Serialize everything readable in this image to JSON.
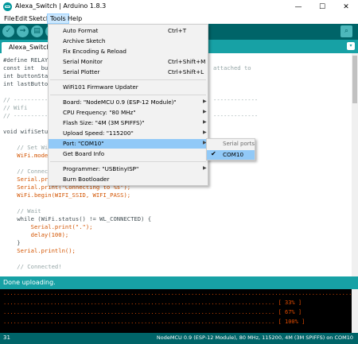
{
  "window": {
    "title": "Alexa_Switch | Arduino 1.8.3"
  },
  "menubar": [
    "File",
    "Edit",
    "Sketch",
    "Tools",
    "Help"
  ],
  "tabs": {
    "sketch": "Alexa_Switch",
    "arrow": "▾"
  },
  "toolbar": {
    "verify": "✓",
    "upload": "→",
    "new": "▤",
    "open": "↑",
    "save": "↓",
    "serial": "⌕"
  },
  "editor": {
    "lines": [
      "#define RELAY",
      "const int  bu",
      "int buttonSta",
      "int lastButto",
      "",
      "// ----------",
      "// Wifi",
      "// ----------",
      "",
      "void wifiSetu",
      "",
      "    // Set Wi",
      "    WiFi.mode",
      "",
      "    // Connec",
      "    Serial.pr",
      "    Serial.print(\"Connecting to %s\");",
      "    WiFi.begin(WIFI_SSID, WIFI_PASS);",
      "",
      "    // Wait",
      "    while (WiFi.status() != WL_CONNECTED) {",
      "        Serial.print(\".\");",
      "        delay(100);",
      "    }",
      "    Serial.println();",
      "",
      "    // Connected!"
    ],
    "right_fragments": [
      "attached to",
      "-------------",
      "-------------"
    ]
  },
  "message": "Done uploading.",
  "console": [
    "........................................................................................................",
    "................................................................................. [ 33% ]",
    "................................................................................. [ 67% ]",
    "................................................................................. [ 100% ]"
  ],
  "status": {
    "line": "31",
    "board": "NodeMCU 0.9 (ESP-12 Module), 80 MHz, 115200, 4M (3M SPIFFS) on COM10"
  },
  "tools_menu": {
    "items": [
      {
        "label": "Auto Format",
        "shortcut": "Ctrl+T"
      },
      {
        "label": "Archive Sketch"
      },
      {
        "label": "Fix Encoding & Reload"
      },
      {
        "label": "Serial Monitor",
        "shortcut": "Ctrl+Shift+M"
      },
      {
        "label": "Serial Plotter",
        "shortcut": "Ctrl+Shift+L"
      },
      {
        "label": "WiFi101 Firmware Updater"
      },
      {
        "label": "Board: \"NodeMCU 0.9 (ESP-12 Module)\""
      },
      {
        "label": "CPU Frequency: \"80 MHz\""
      },
      {
        "label": "Flash Size: \"4M (3M SPIFFS)\""
      },
      {
        "label": "Upload Speed: \"115200\""
      },
      {
        "label": "Port: \"COM10\""
      },
      {
        "label": "Get Board Info"
      },
      {
        "label": "Programmer: \"USBtinyISP\""
      },
      {
        "label": "Burn Bootloader"
      }
    ]
  },
  "port_submenu": {
    "header": "Serial ports",
    "option": "COM10",
    "check": "✔"
  }
}
